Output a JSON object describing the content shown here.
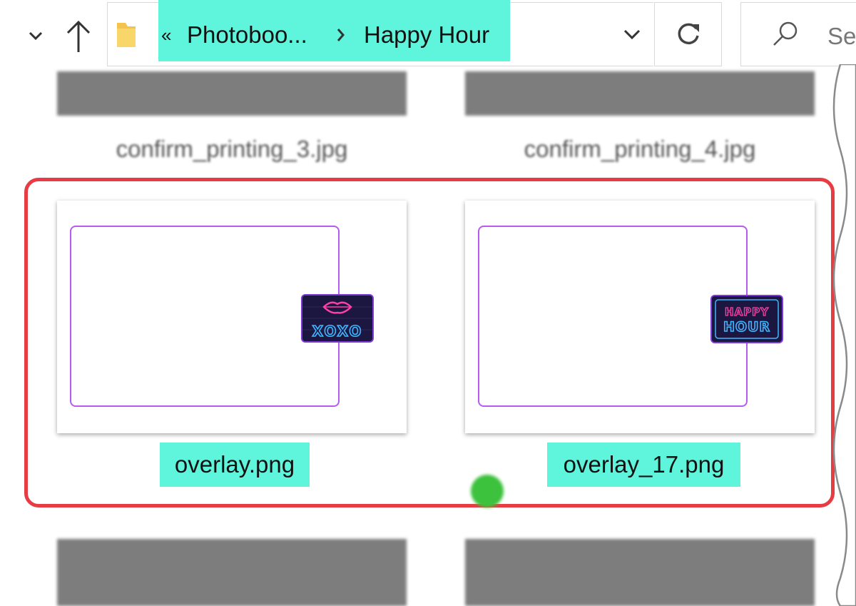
{
  "window": {
    "breadcrumb": {
      "overflow_marker": "«",
      "items": [
        "Photoboo...",
        "Happy Hour"
      ]
    },
    "search": {
      "placeholder_visible": "Se"
    }
  },
  "files": [
    {
      "name": "confirm_printing_3.jpg",
      "blurred": true
    },
    {
      "name": "confirm_printing_4.jpg",
      "blurred": true
    },
    {
      "name": "overlay.png",
      "selected": true,
      "sticker_text": "XOXO"
    },
    {
      "name": "overlay_17.png",
      "selected": true,
      "sticker_text": [
        "HAPPY",
        "HOUR"
      ]
    }
  ],
  "colors": {
    "highlight": "#5ef5dc",
    "selection_border": "#e83c44",
    "frame_border": "#b75bf0",
    "neon_pink": "#ff3fa8",
    "neon_blue": "#3fb6ff"
  },
  "icons": {
    "back": "chevron-down-icon",
    "up": "arrow-up-icon",
    "folder": "folder-icon",
    "separator": "chevron-right-icon",
    "dropdown": "chevron-down-icon",
    "refresh": "refresh-icon",
    "search": "search-icon"
  }
}
